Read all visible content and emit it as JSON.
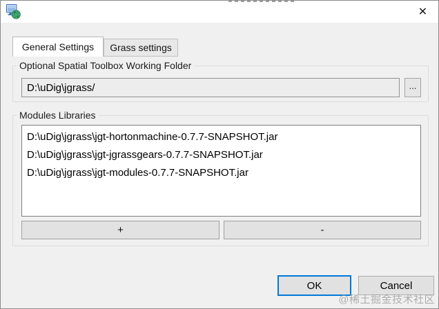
{
  "window": {
    "close_icon_glyph": "✕"
  },
  "tabs": [
    {
      "label": "General Settings",
      "active": true
    },
    {
      "label": "Grass settings",
      "active": false
    }
  ],
  "working_folder_group": {
    "title": "Optional Spatial Toolbox Working Folder",
    "path_value": "D:\\uDig\\jgrass/",
    "browse_button_label": "..."
  },
  "modules_group": {
    "title": "Modules Libraries",
    "items": [
      "D:\\uDig\\jgrass\\jgt-hortonmachine-0.7.7-SNAPSHOT.jar",
      "D:\\uDig\\jgrass\\jgt-jgrassgears-0.7.7-SNAPSHOT.jar",
      "D:\\uDig\\jgrass\\jgt-modules-0.7.7-SNAPSHOT.jar"
    ],
    "add_button_label": "+",
    "remove_button_label": "-"
  },
  "footer": {
    "ok_label": "OK",
    "cancel_label": "Cancel"
  },
  "watermark_text": "@稀土掘金技术社区",
  "colors": {
    "accent_blue": "#0078d7",
    "dialog_bg": "#f0f0f0",
    "titlebar_bg": "#ffffff"
  }
}
